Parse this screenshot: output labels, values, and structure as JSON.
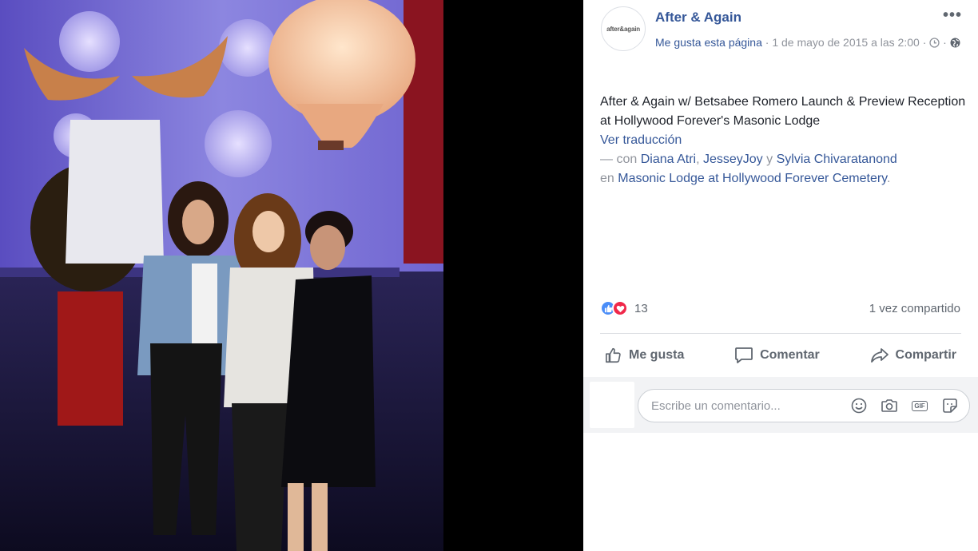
{
  "post": {
    "page_name": "After & Again",
    "avatar_text": "after&again",
    "like_page": "Me gusta esta página",
    "separator": "·",
    "timestamp": "1 de mayo de 2015 a las 2:00",
    "more": "•••",
    "text": "After & Again w/ Betsabee Romero Launch & Preview Reception at Hollywood Forever's Masonic Lodge",
    "translate": "Ver traducción",
    "with_prefix": "— con",
    "tagged": [
      "Diana Atri",
      "JesseyJoy",
      "Sylvia Chivaratanond"
    ],
    "tag_sep": ",",
    "tag_and": "y",
    "location_prefix": "en",
    "location": "Masonic Lodge at Hollywood Forever Cemetery",
    "location_end": "."
  },
  "stats": {
    "reaction_icons": [
      "like-reaction-icon",
      "love-reaction-icon"
    ],
    "reaction_count": "13",
    "shares": "1 vez compartido"
  },
  "actions": {
    "like": "Me gusta",
    "comment": "Comentar",
    "share": "Compartir"
  },
  "comment": {
    "placeholder": "Escribe un comentario...",
    "icons": [
      "emoji-icon",
      "camera-icon",
      "gif-icon",
      "sticker-icon"
    ],
    "gif_label": "GIF"
  },
  "colors": {
    "link": "#365899",
    "muted": "#90949c",
    "like": "#4a8df8",
    "love": "#f0284a"
  }
}
